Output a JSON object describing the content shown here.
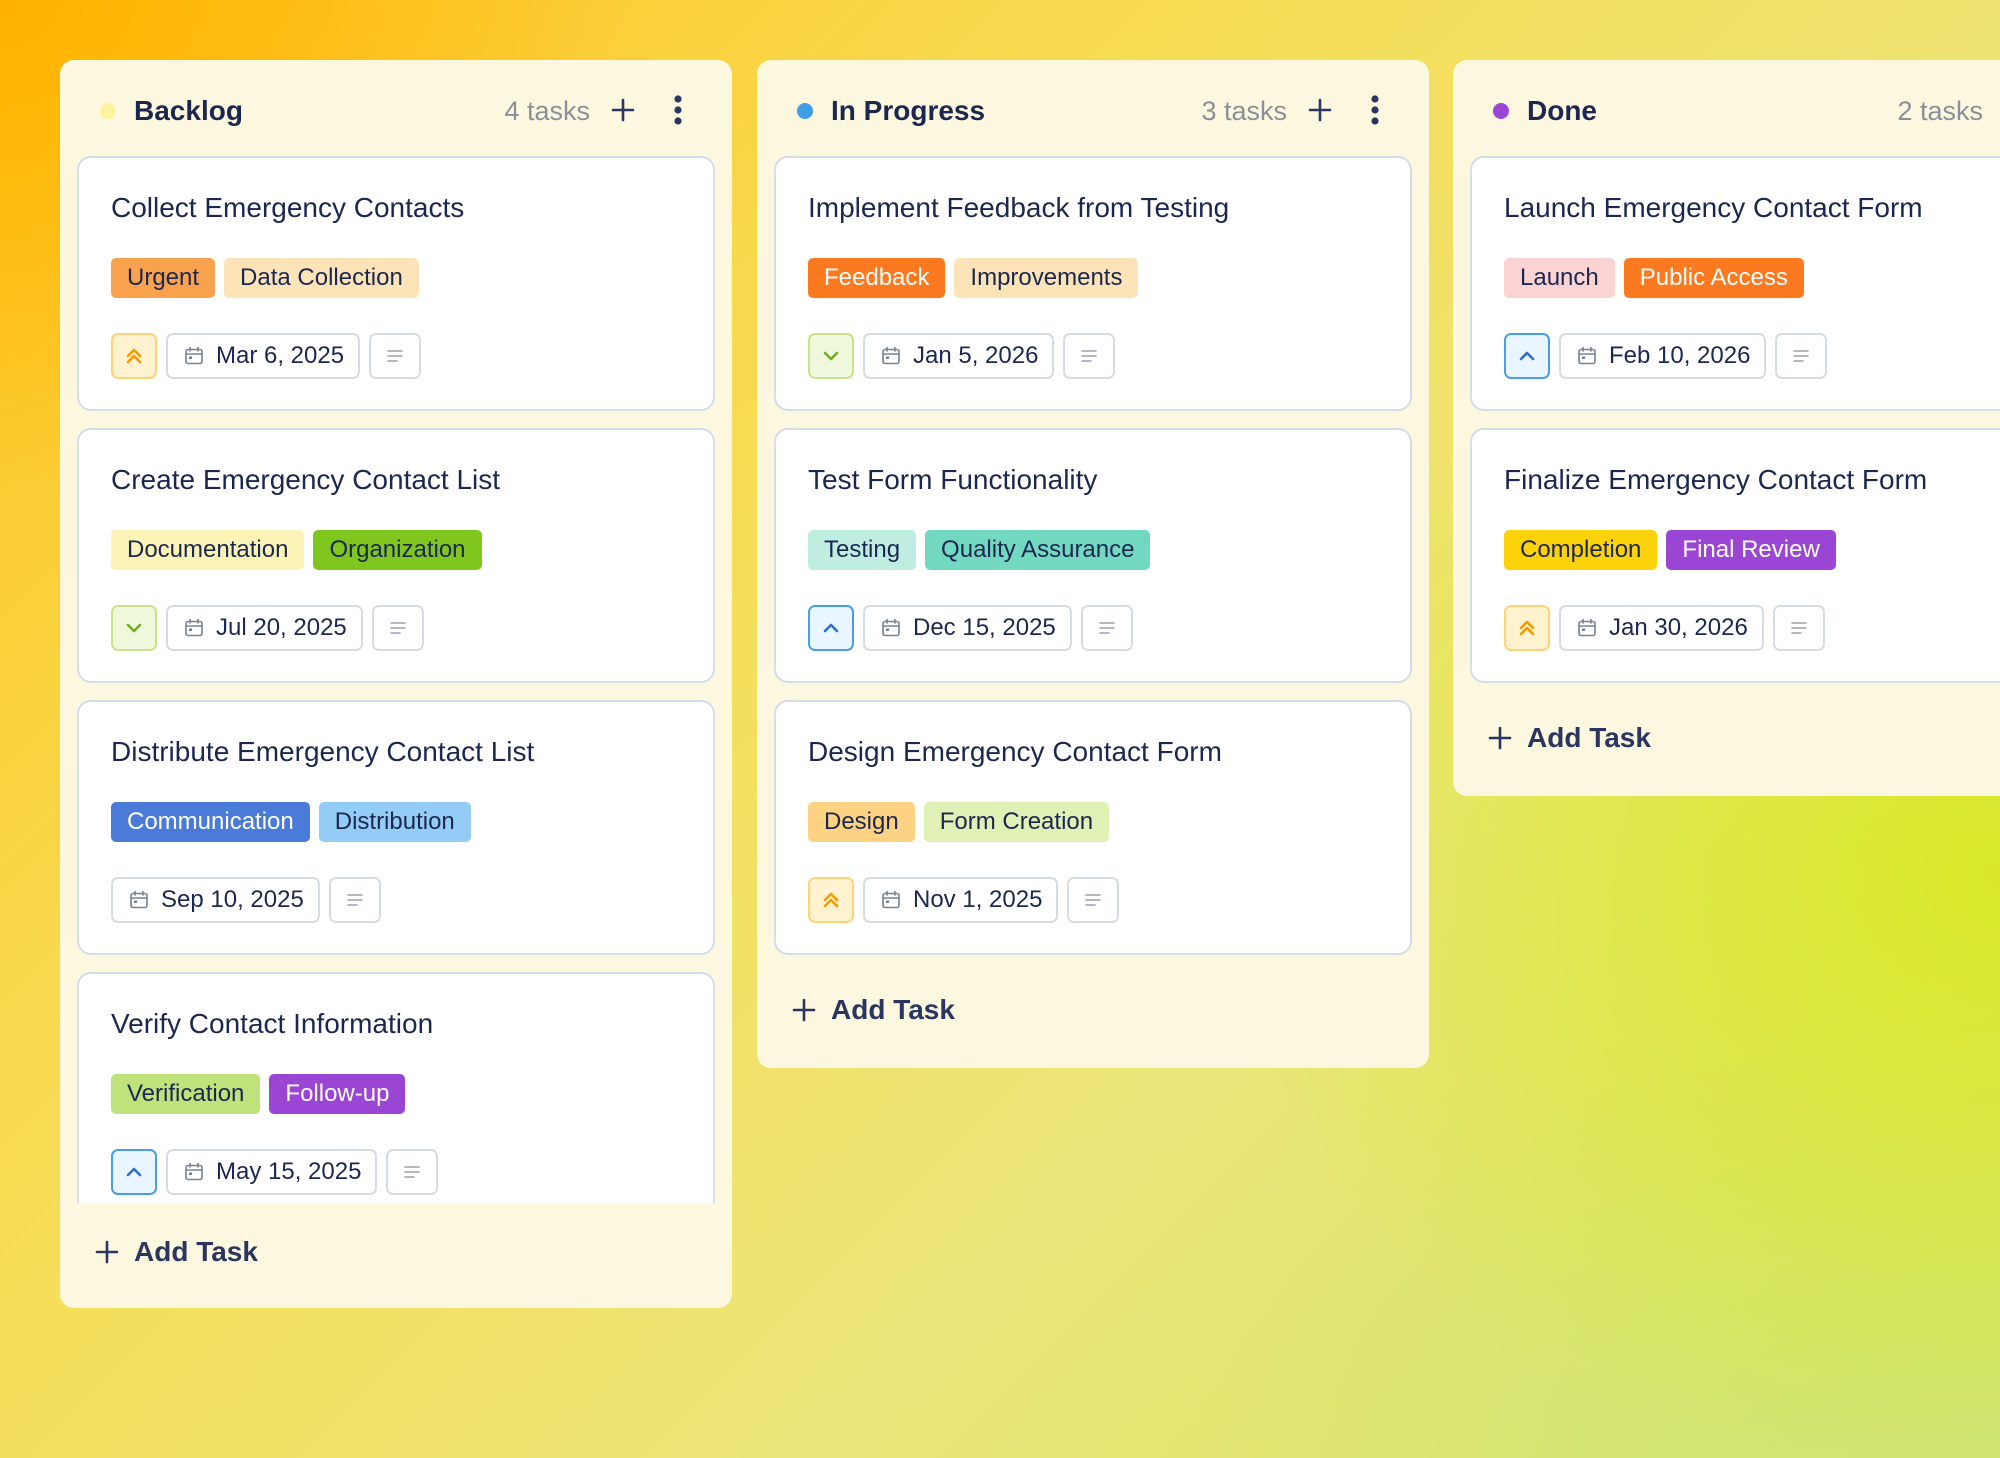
{
  "colors": {
    "column_bg": "#fcf8df",
    "title_text": "#1c2750"
  },
  "columns": [
    {
      "title": "Backlog",
      "count": "4 tasks",
      "dot_color": "#fdf3a0",
      "add_task_label": "Add Task",
      "cards": [
        {
          "title": "Collect Emergency Contacts",
          "tags": [
            {
              "label": "Urgent",
              "bg": "#f9a24e",
              "color": "#1c2750"
            },
            {
              "label": "Data Collection",
              "bg": "#fde4b8",
              "color": "#1c2750"
            }
          ],
          "priority": "urgent",
          "date": "Mar 6, 2025"
        },
        {
          "title": "Create Emergency Contact List",
          "tags": [
            {
              "label": "Documentation",
              "bg": "#fcf3b6",
              "color": "#1c2750"
            },
            {
              "label": "Organization",
              "bg": "#7fc71f",
              "color": "#1c2750"
            }
          ],
          "priority": "low",
          "date": "Jul 20, 2025"
        },
        {
          "title": "Distribute Emergency Contact List",
          "tags": [
            {
              "label": "Communication",
              "bg": "#4a7bd8",
              "color": "#ffffff"
            },
            {
              "label": "Distribution",
              "bg": "#93cdf6",
              "color": "#1c2750"
            }
          ],
          "priority": "none",
          "date": "Sep 10, 2025"
        },
        {
          "title": "Verify Contact Information",
          "tags": [
            {
              "label": "Verification",
              "bg": "#bfe27a",
              "color": "#1c2750"
            },
            {
              "label": "Follow-up",
              "bg": "#9b45d4",
              "color": "#ffffff"
            }
          ],
          "priority": "high",
          "date": "May 15, 2025"
        }
      ]
    },
    {
      "title": "In Progress",
      "count": "3 tasks",
      "dot_color": "#3f9de8",
      "add_task_label": "Add Task",
      "cards": [
        {
          "title": "Implement Feedback from Testing",
          "tags": [
            {
              "label": "Feedback",
              "bg": "#fb7a20",
              "color": "#ffffff"
            },
            {
              "label": "Improvements",
              "bg": "#fde4b8",
              "color": "#1c2750"
            }
          ],
          "priority": "low",
          "date": "Jan 5, 2026"
        },
        {
          "title": "Test Form Functionality",
          "tags": [
            {
              "label": "Testing",
              "bg": "#bfeee0",
              "color": "#1c2750"
            },
            {
              "label": "Quality Assurance",
              "bg": "#73d8c0",
              "color": "#1c2750"
            }
          ],
          "priority": "high",
          "date": "Dec 15, 2025"
        },
        {
          "title": "Design Emergency Contact Form",
          "tags": [
            {
              "label": "Design",
              "bg": "#fdd282",
              "color": "#1c2750"
            },
            {
              "label": "Form Creation",
              "bg": "#dff1b4",
              "color": "#1c2750"
            }
          ],
          "priority": "urgent",
          "date": "Nov 1, 2025"
        }
      ]
    },
    {
      "title": "Done",
      "count": "2 tasks",
      "dot_color": "#9b45d4",
      "add_task_label": "Add Task",
      "cards": [
        {
          "title": "Launch Emergency Contact Form",
          "tags": [
            {
              "label": "Launch",
              "bg": "#fbd3d3",
              "color": "#1c2750"
            },
            {
              "label": "Public Access",
              "bg": "#fb7a20",
              "color": "#ffffff"
            }
          ],
          "priority": "high",
          "date": "Feb 10, 2026"
        },
        {
          "title": "Finalize Emergency Contact Form",
          "tags": [
            {
              "label": "Completion",
              "bg": "#fcd20a",
              "color": "#1c2750"
            },
            {
              "label": "Final Review",
              "bg": "#9b45d4",
              "color": "#ffffff"
            }
          ],
          "priority": "urgent",
          "date": "Jan 30, 2026"
        }
      ]
    }
  ]
}
